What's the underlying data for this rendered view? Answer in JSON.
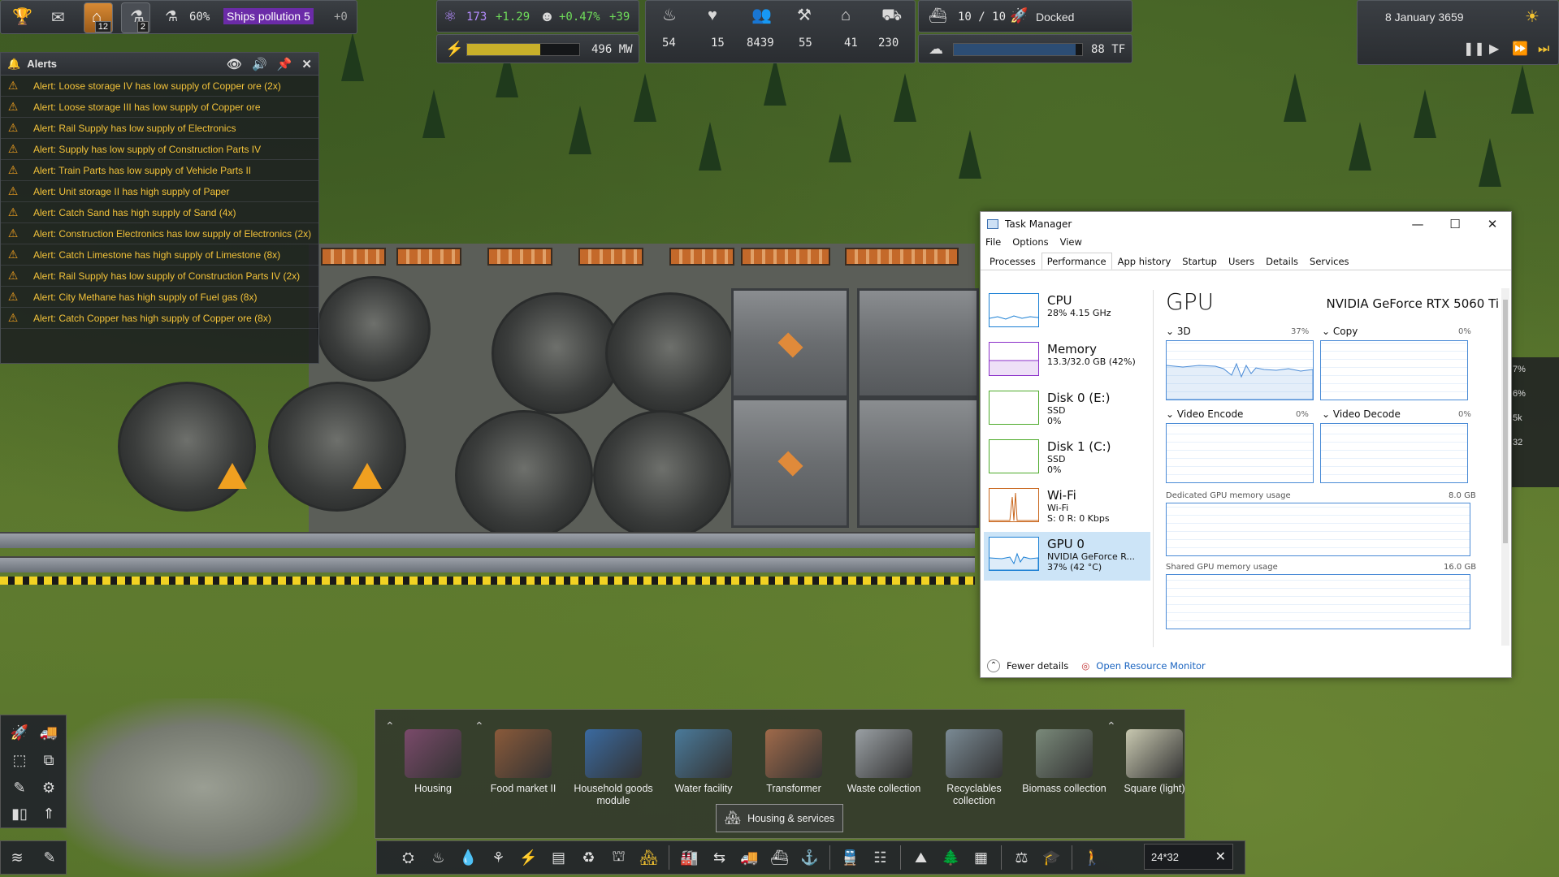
{
  "hud": {
    "pollution_pct": "60%",
    "pollution_label": "Ships pollution 5",
    "pollution_delta": "+0",
    "notif_count_1": "12",
    "notif_count_2": "2",
    "unity": "173",
    "unity_delta": "+1.29",
    "pop_growth": "+0.47%",
    "pop_delta": "+39",
    "power": "496 MW",
    "power_fill": 0.65,
    "food": "54",
    "health": "15",
    "population": "8439",
    "workers": "55",
    "housing": "41",
    "vehicles": "230",
    "ships": "10 / 10",
    "ship_status": "Docked",
    "compute": "88 TF",
    "compute_fill": 0.95,
    "date": "8 January 3659"
  },
  "alerts": {
    "title": "Alerts",
    "items": [
      "Alert: Loose storage IV has low supply of Copper ore (2x)",
      "Alert: Loose storage III has low supply of Copper ore",
      "Alert: Rail Supply has low supply of Electronics",
      "Alert: Supply has low supply of Construction Parts IV",
      "Alert: Train Parts has low supply of Vehicle Parts II",
      "Alert: Unit storage II has high supply of Paper",
      "Alert: Catch Sand has high supply of Sand (4x)",
      "Alert: Construction Electronics has low supply of Electronics (2x)",
      "Alert: Catch Limestone has high supply of Limestone (8x)",
      "Alert: Rail Supply has low supply of Construction Parts IV (2x)",
      "Alert: City Methane has high supply of Fuel gas (8x)",
      "Alert: Catch Copper has high supply of Copper ore (8x)"
    ]
  },
  "taskmanager": {
    "title": "Task Manager",
    "menu": [
      "File",
      "Options",
      "View"
    ],
    "tabs": [
      "Processes",
      "Performance",
      "App history",
      "Startup",
      "Users",
      "Details",
      "Services"
    ],
    "active_tab": "Performance",
    "resources": [
      {
        "name": "CPU",
        "l1": "28% 4.15 GHz",
        "l2": "",
        "l3": "",
        "color": "#1a7fd4"
      },
      {
        "name": "Memory",
        "l1": "13.3/32.0 GB (42%)",
        "l2": "",
        "l3": "",
        "color": "#8b2fc9"
      },
      {
        "name": "Disk 0 (E:)",
        "l1": "SSD",
        "l2": "0%",
        "l3": "",
        "color": "#4daa2a"
      },
      {
        "name": "Disk 1 (C:)",
        "l1": "SSD",
        "l2": "0%",
        "l3": "",
        "color": "#4daa2a"
      },
      {
        "name": "Wi-Fi",
        "l1": "Wi-Fi",
        "l2": "S: 0 R: 0 Kbps",
        "l3": "",
        "color": "#c8651a"
      },
      {
        "name": "GPU 0",
        "l1": "NVIDIA GeForce R...",
        "l2": "37% (42 °C)",
        "l3": "",
        "color": "#1a7fd4"
      }
    ],
    "gpu_title": "GPU",
    "gpu_model": "NVIDIA GeForce RTX 5060 Ti",
    "engines": [
      {
        "label": "3D",
        "pct": "37%"
      },
      {
        "label": "Copy",
        "pct": "0%"
      },
      {
        "label": "Video Encode",
        "pct": "0%"
      },
      {
        "label": "Video Decode",
        "pct": "0%"
      }
    ],
    "dedicated_label": "Dedicated GPU memory usage",
    "dedicated_max": "8.0 GB",
    "shared_label": "Shared GPU memory usage",
    "shared_max": "16.0 GB",
    "fewer_details": "Fewer details",
    "open_monitor": "Open Resource Monitor"
  },
  "build": {
    "items": [
      {
        "label": "Housing",
        "color": "#7a4a6a"
      },
      {
        "label": "Food market II",
        "color": "#8a5a3a"
      },
      {
        "label": "Household goods module",
        "color": "#3a6aa0"
      },
      {
        "label": "Water facility",
        "color": "#4a7a9a"
      },
      {
        "label": "Transformer",
        "color": "#a06a4a"
      },
      {
        "label": "Waste collection",
        "color": "#9aa0a4"
      },
      {
        "label": "Recyclables collection",
        "color": "#7a8a94"
      },
      {
        "label": "Biomass collection",
        "color": "#7a8a7a"
      },
      {
        "label": "Square (light)",
        "color": "#c8c8b0"
      }
    ],
    "category": "Housing & services",
    "size_value": "24*32"
  },
  "right_stats": [
    "7%",
    "6%",
    "5k",
    "32"
  ]
}
